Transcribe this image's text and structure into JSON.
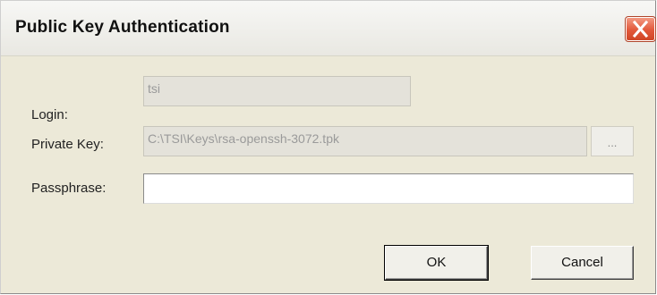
{
  "window": {
    "title": "Public Key Authentication",
    "close_symbol": "close-icon"
  },
  "form": {
    "login_label": "Login:",
    "login_value": "tsi",
    "private_key_label": "Private Key:",
    "private_key_value": "C:\\TSI\\Keys\\rsa-openssh-3072.tpk",
    "browse_label": "...",
    "passphrase_label": "Passphrase:",
    "passphrase_value": ""
  },
  "buttons": {
    "ok_label": "OK",
    "cancel_label": "Cancel"
  },
  "colors": {
    "dialog_background": "#ece9d8",
    "close_button": "#e2583a"
  }
}
